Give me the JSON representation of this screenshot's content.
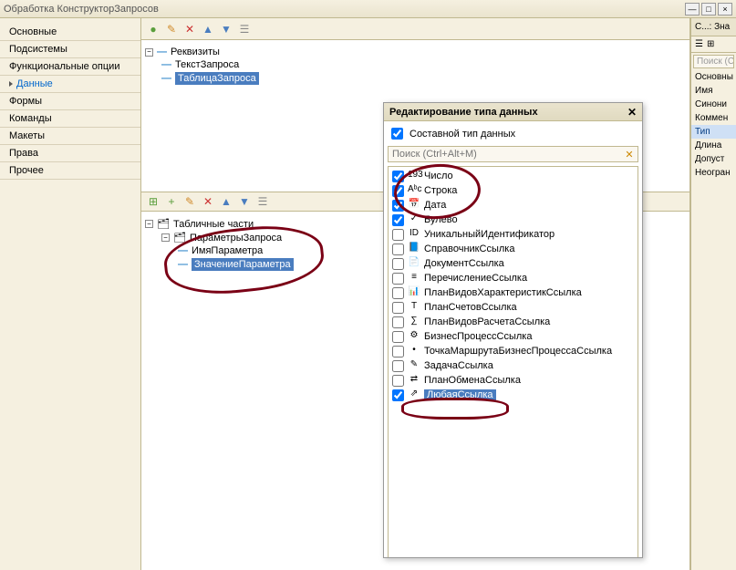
{
  "window": {
    "title": "Обработка КонструкторЗапросов"
  },
  "nav": {
    "items": [
      "Основные",
      "Подсистемы",
      "Функциональные опции",
      "Данные",
      "Формы",
      "Команды",
      "Макеты",
      "Права",
      "Прочее"
    ],
    "active_index": 3
  },
  "tree1": {
    "root": "Реквизиты",
    "child1": "ТекстЗапроса",
    "child2": "ТаблицаЗапроса"
  },
  "tree2": {
    "root": "Табличные части",
    "child1": "ПараметрыЗапроса",
    "gchild1": "ИмяПараметра",
    "gchild2": "ЗначениеПараметра"
  },
  "dialog": {
    "title": "Редактирование типа данных",
    "composite_label": "Составной тип данных",
    "search_placeholder": "Поиск (Ctrl+Alt+M)",
    "types": [
      {
        "label": "Число",
        "checked": true,
        "icon": "193",
        "selected": false
      },
      {
        "label": "Строка",
        "checked": true,
        "icon": "Aᵇc",
        "selected": false
      },
      {
        "label": "Дата",
        "checked": true,
        "icon": "📅",
        "selected": false
      },
      {
        "label": "Булево",
        "checked": true,
        "icon": "✓",
        "selected": false
      },
      {
        "label": "УникальныйИдентификатор",
        "checked": false,
        "icon": "ID",
        "selected": false
      },
      {
        "label": "СправочникСсылка",
        "checked": false,
        "icon": "📘",
        "selected": false
      },
      {
        "label": "ДокументСсылка",
        "checked": false,
        "icon": "📄",
        "selected": false
      },
      {
        "label": "ПеречислениеСсылка",
        "checked": false,
        "icon": "≡",
        "selected": false
      },
      {
        "label": "ПланВидовХарактеристикСсылка",
        "checked": false,
        "icon": "📊",
        "selected": false
      },
      {
        "label": "ПланСчетовСсылка",
        "checked": false,
        "icon": "Т",
        "selected": false
      },
      {
        "label": "ПланВидовРасчетаСсылка",
        "checked": false,
        "icon": "∑",
        "selected": false
      },
      {
        "label": "БизнесПроцессСсылка",
        "checked": false,
        "icon": "⚙",
        "selected": false
      },
      {
        "label": "ТочкаМаршрутаБизнесПроцессаСсылка",
        "checked": false,
        "icon": "•",
        "selected": false
      },
      {
        "label": "ЗадачаСсылка",
        "checked": false,
        "icon": "✎",
        "selected": false
      },
      {
        "label": "ПланОбменаСсылка",
        "checked": false,
        "icon": "⇄",
        "selected": false
      },
      {
        "label": "ЛюбаяСсылка",
        "checked": true,
        "icon": "⇗",
        "selected": true
      }
    ]
  },
  "right_panel": {
    "title": "С...: Зна",
    "search": "Поиск (Ctr",
    "items": [
      "Основны",
      "Имя",
      "Синони",
      "Коммен",
      "Тип",
      "Длина",
      "Допуст",
      "Неогран"
    ],
    "active_index": 4
  }
}
